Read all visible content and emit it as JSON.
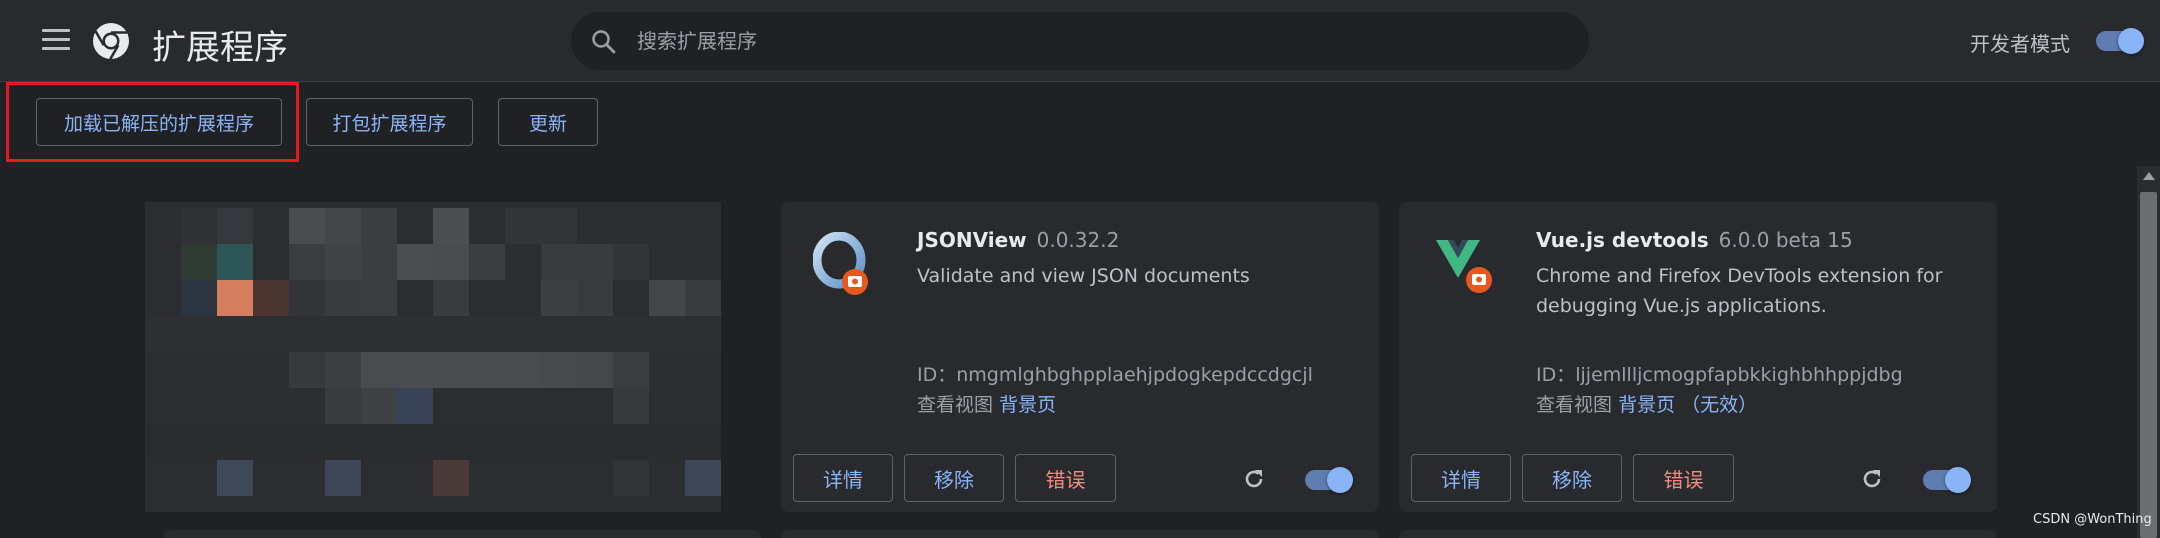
{
  "header": {
    "title": "扩展程序",
    "search_placeholder": "搜索扩展程序",
    "dev_mode_label": "开发者模式",
    "dev_mode_on": true
  },
  "toolbar": {
    "load_unpacked": "加载已解压的扩展程序",
    "pack": "打包扩展程序",
    "update": "更新"
  },
  "extensions": [
    {
      "name": "JSONView",
      "version": "0.0.32.2",
      "description": "Validate and view JSON documents",
      "id_label": "ID：",
      "id": "nmgmlghbghpplaehjpdogkepdccdgcjl",
      "views_label": "查看视图",
      "views_link": "背景页",
      "details": "详情",
      "remove": "移除",
      "errors": "错误",
      "enabled": true
    },
    {
      "name": "Vue.js devtools",
      "version": "6.0.0 beta 15",
      "description_line1": "Chrome and Firefox DevTools extension for",
      "description_line2": "debugging Vue.js applications.",
      "id_label": "ID：",
      "id": "ljjemllljcmogpfapbkkighbhhppjdbg",
      "views_label": "查看视图",
      "views_link": "背景页",
      "views_suffix": "（无效）",
      "details": "详情",
      "remove": "移除",
      "errors": "错误",
      "enabled": true
    }
  ],
  "watermark": "CSDN @WonThing",
  "colors": {
    "accent": "#8ab4f8",
    "error": "#f28b82",
    "highlight": "#e5191f"
  },
  "icons": [
    "menu-icon",
    "chrome-logo-icon",
    "search-icon",
    "reload-icon",
    "jsonview-icon",
    "vue-icon"
  ]
}
